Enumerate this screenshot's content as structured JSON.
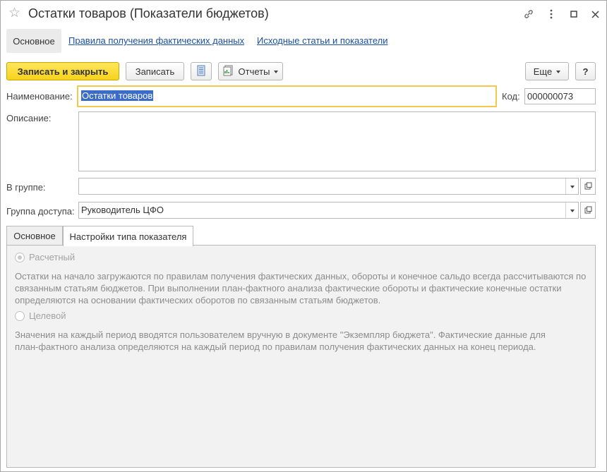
{
  "window": {
    "title": "Остатки товаров (Показатели бюджетов)",
    "icons": [
      "star-icon",
      "link-icon",
      "more-icon",
      "maximize-icon",
      "close-icon"
    ]
  },
  "nav": {
    "current": "Основное",
    "links": [
      "Правила получения фактических данных",
      "Исходные статьи и показатели"
    ]
  },
  "toolbar": {
    "save_close": "Записать и закрыть",
    "save": "Записать",
    "reports": "Отчеты",
    "more": "Еще",
    "help": "?"
  },
  "form": {
    "name_label": "Наименование:",
    "name_value": "Остатки товаров",
    "code_label": "Код:",
    "code_value": "000000073",
    "description_label": "Описание:",
    "description_value": "",
    "group_label": "В группе:",
    "group_value": "",
    "access_label": "Группа доступа:",
    "access_value": "Руководитель ЦФО"
  },
  "tabs": {
    "items": [
      "Основное",
      "Настройки типа показателя"
    ],
    "active": "Настройки типа показателя"
  },
  "indicator_type": {
    "options": [
      {
        "label": "Расчетный",
        "selected": true,
        "description": [
          "Остатки на начало загружаются по правилам получения фактических данных, обороты и конечное сальдо всегда рассчитываются по",
          "связанным статьям бюджетов. При выполнении план-фактного анализа фактические обороты и фактические конечные остатки",
          "определяются на основании фактических оборотов по связанным статьям бюджетов."
        ]
      },
      {
        "label": "Целевой",
        "selected": false,
        "description": [
          "Значения на каждый период вводятся пользователем вручную в документе \"Экземпляр бюджета\". Фактические данные для",
          "план-фактного анализа определяются на каждый период по правилам получения фактических данных на конец периода."
        ]
      }
    ]
  },
  "colors": {
    "primary_button": "#f7d21c",
    "link": "#1a4fa0",
    "selection": "#3b6cc9",
    "focus_border": "#f2c94c"
  }
}
